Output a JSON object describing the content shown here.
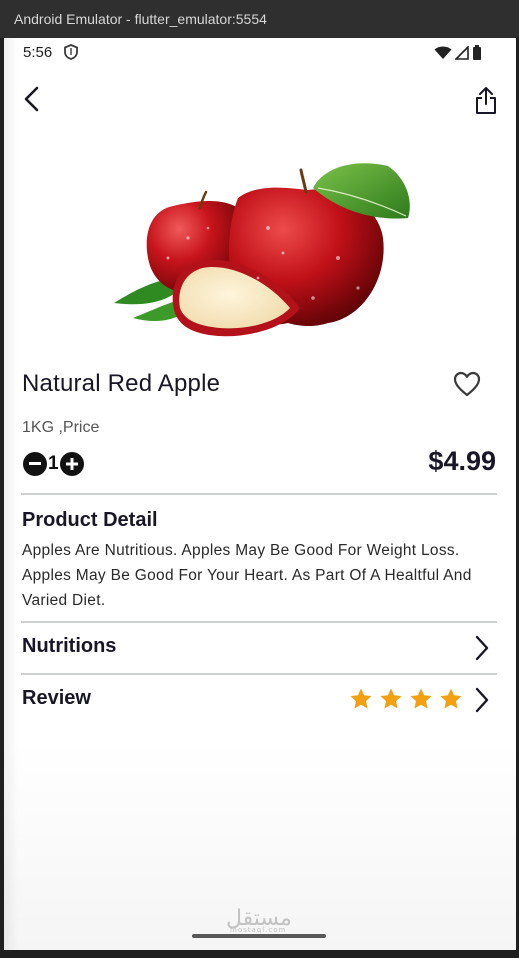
{
  "window": {
    "title": "Android Emulator - flutter_emulator:5554"
  },
  "status_bar": {
    "time": "5:56",
    "shield_icon": "shield-icon",
    "wifi_icon": "wifi-icon",
    "signal_icon": "signal-icon",
    "battery_icon": "battery-icon"
  },
  "toolbar": {
    "back_icon": "chevron-left-icon",
    "share_icon": "share-icon"
  },
  "product": {
    "name": "Natural Red Apple",
    "subtitle": "1KG ,Price",
    "quantity": "1",
    "price": "$4.99",
    "image": "red-apples-image",
    "favorite_icon": "heart-outline-icon"
  },
  "sections": {
    "detail_title": "Product Detail",
    "detail_text": "Apples Are Nutritious. Apples May Be Good For Weight Loss. Apples May Be Good For Your Heart. As Part Of A Healtful And Varied Diet.",
    "nutritions_label": "Nutritions",
    "review_label": "Review",
    "review_stars": 4
  },
  "watermark": {
    "text": "مستقل",
    "sub": "mostaql.com"
  },
  "colors": {
    "star": "#F3A013",
    "text": "#181725",
    "divider": "#CFCFD6"
  }
}
